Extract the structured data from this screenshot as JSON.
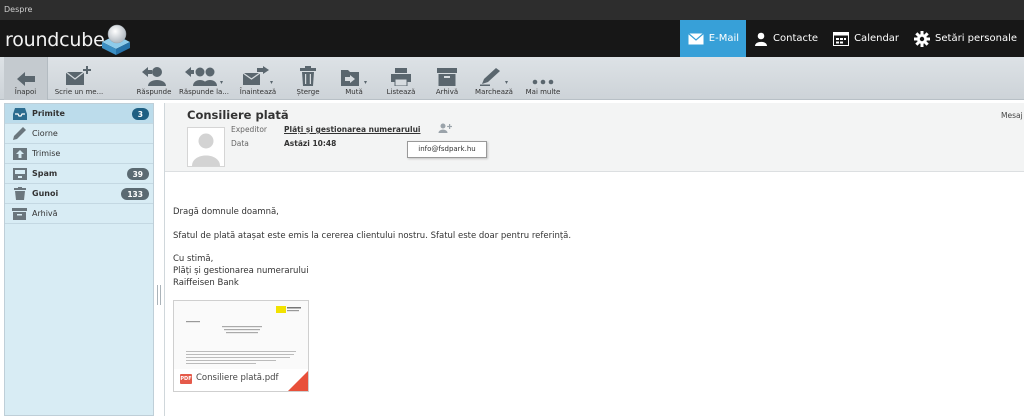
{
  "window": {
    "title": "Despre"
  },
  "app": {
    "logo_text": "roundcube"
  },
  "nav": [
    {
      "label": "E-Mail",
      "icon": "envelope-icon",
      "active": true
    },
    {
      "label": "Contacte",
      "icon": "person-icon",
      "active": false
    },
    {
      "label": "Calendar",
      "icon": "calendar-icon",
      "active": false
    },
    {
      "label": "Setări personale",
      "icon": "gear-icon",
      "active": false
    }
  ],
  "toolbar": {
    "back": "Înapoi",
    "compose": "Scrie un me...",
    "reply": "Răspunde",
    "reply_all": "Răspunde la...",
    "forward": "Înaintează",
    "delete": "Șterge",
    "move": "Mută",
    "print": "Listează",
    "archive": "Arhivă",
    "mark": "Marchează",
    "more": "Mai multe"
  },
  "folders": [
    {
      "label": "Primite",
      "icon": "inbox-icon",
      "bold": true,
      "badge": "3",
      "selected": true
    },
    {
      "label": "Ciorne",
      "icon": "pencil-icon",
      "bold": false,
      "badge": "",
      "selected": false
    },
    {
      "label": "Trimise",
      "icon": "sent-icon",
      "bold": false,
      "badge": "",
      "selected": false
    },
    {
      "label": "Spam",
      "icon": "spam-icon",
      "bold": true,
      "badge": "39",
      "selected": false
    },
    {
      "label": "Gunoi",
      "icon": "trash-icon",
      "bold": true,
      "badge": "133",
      "selected": false
    },
    {
      "label": "Arhivă",
      "icon": "archive-icon",
      "bold": false,
      "badge": "",
      "selected": false
    }
  ],
  "message": {
    "subject": "Consiliere plată",
    "right_label": "Mesaj",
    "from_label": "Expeditor",
    "from_value": "Plăți și gestionarea numerarului",
    "date_label": "Data",
    "date_value": "Astăzi 10:48",
    "tooltip_email": "info@fsdpark.hu",
    "body": {
      "greeting": "Dragă domnule doamnă,",
      "paragraph": "Sfatul de plată atașat este emis la cererea clientului nostru. Sfatul este doar pentru referință.",
      "closing": "Cu stimă,",
      "signature_1": "Plăți și gestionarea numerarului",
      "signature_2": "Raiffeisen Bank"
    },
    "attachment": {
      "file_type": "PDF",
      "name": "Consiliere plată.pdf"
    }
  },
  "colors": {
    "header_bg": "#171717",
    "accent": "#37a0d8",
    "folder_bg": "#d8ecf4",
    "badge": "#5b6a72",
    "pdf_red": "#e8503a"
  }
}
